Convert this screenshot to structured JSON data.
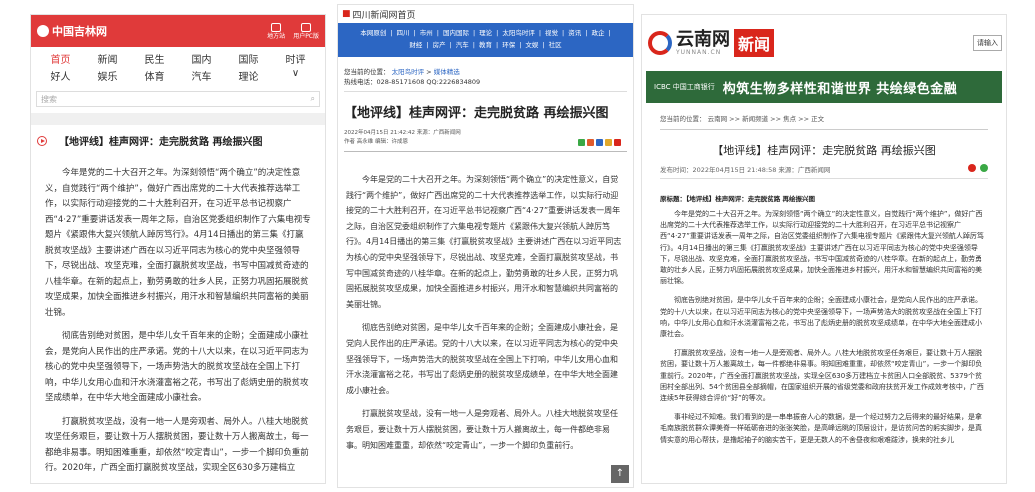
{
  "panel1": {
    "logo": "中国吉林网",
    "topbar_buttons": [
      "地方站",
      "用户PC版"
    ],
    "nav": [
      "首页",
      "新闻",
      "民生",
      "国内",
      "国际",
      "时评",
      "好人",
      "娱乐",
      "体育",
      "汽车",
      "理论",
      "∨"
    ],
    "search_placeholder": "搜索",
    "search_icon": "search-icon",
    "article_title": "【地评线】桂声网评：走完脱贫路 再绘振兴图",
    "paragraphs": [
      "今年是党的二十大召开之年。为深刻领悟“两个确立”的决定性意义，自觉践行“两个维护”，做好广西出席党的二十大代表推荐选举工作，以实际行动迎接党的二十大胜利召开，在习近平总书记视察广西“4·27”重要讲话发表一周年之际，自治区党委组织制作了六集电视专题片《紧跟伟大复兴领航人踔厉笃行》。4月14日播出的第三集《打赢脱贫攻坚战》主要讲述广西在以习近平同志为核心的党中央坚强领导下，尽锐出战、攻坚克难，全面打赢脱贫攻坚战，书写中国减贫奇迹的八桂华章。在新的起点上，勤劳勇敢的壮乡人民，正努力巩固拓展脱贫攻坚成果，加快全面推进乡村振兴，用汗水和智慧编织共同富裕的美丽壮锦。",
      "彻底告别绝对贫困，是中华儿女千百年来的企盼；全面建成小康社会，是党向人民作出的庄严承诺。党的十八大以来，在以习近平同志为核心的党中央坚强领导下，一场声势浩大的脱贫攻坚战在全国上下打响，中华儿女用心血和汗水浇灌富裕之花，书写出了彪炳史册的脱贫攻坚成绩单，在中华大地全面建成小康社会。",
      "打赢脱贫攻坚战，没有一地一人是旁观者、局外人。八桂大地脱贫攻坚任务艰巨，要让数十万人摆脱贫困，要让数十万人搬离故土，每一都绝非易事。明知困难重重，却依然“咬定青山”，一步一个脚印负重前行。2020年，广西全面打赢脱贫攻坚战，实现全区630多万建档立"
    ]
  },
  "panel2": {
    "site_name": "四川新闻网首页",
    "nav_row1": [
      "本网原创",
      "四川",
      "市州",
      "国内国际",
      "理论",
      "太阳鸟时评",
      "视觉",
      "资讯",
      "政企"
    ],
    "nav_row2": [
      "财经",
      "房产",
      "汽车",
      "教育",
      "环保",
      "文娱",
      "社区"
    ],
    "breadcrumb_prefix": "您当前的位置：",
    "breadcrumb_items": [
      "太阳鸟时评",
      ">",
      "媒体精选"
    ],
    "hotline": "热线电话：028-85171608 QQ:2226834809",
    "article_title": "【地评线】桂声网评：走完脱贫路 再绘振兴图",
    "meta_line": "2022年04月15日 21:42:42   来源：广西新闻网",
    "author_line": "作者 高永维  编辑：许成恩",
    "paragraphs": [
      "今年是党的二十大召开之年。为深刻领悟“两个确立”的决定性意义，自觉践行“两个维护”，做好广西出席党的二十大代表推荐选举工作，以实际行动迎接党的二十大胜利召开，在习近平总书记视察广西“4·27”重要讲话发表一周年之际，自治区党委组织制作了六集电视专题片《紧跟伟大复兴领航人踔厉笃行》。4月14日播出的第三集《打赢脱贫攻坚战》主要讲述广西在以习近平同志为核心的党中央坚强领导下，尽锐出战、攻坚克难，全面打赢脱贫攻坚战，书写中国减贫奇迹的八桂华章。在新的起点上，勤劳勇敢的壮乡人民，正努力巩固拓展脱贫攻坚成果，加快全面推进乡村振兴，用汗水和智慧编织共同富裕的美丽壮锦。",
      "彻底告别绝对贫困，是中华儿女千百年来的企盼；全面建成小康社会，是党向人民作出的庄严承诺。党的十八大以来，在以习近平同志为核心的党中央坚强领导下，一场声势浩大的脱贫攻坚战在全国上下打响，中华儿女用心血和汗水浇灌富裕之花，书写出了彪炳史册的脱贫攻坚成绩单，在中华大地全面建成小康社会。",
      "打赢脱贫攻坚战，没有一地一人是旁观者、局外人。八桂大地脱贫攻坚任务艰巨，要让数十万人摆脱贫困，要让数十万人搬离故土，每一件都绝非易事。明知困难重重，却依然“咬定青山”，一步一个脚印负重前行。"
    ],
    "totop_label": "↑"
  },
  "panel3": {
    "site_name": "云南网",
    "site_sub": "YUNNAN.CN",
    "news_label": "新闻",
    "login_label": "请输入",
    "banner_bank": "ICBC 中国工商银行",
    "banner_slogan": "构筑生物多样性和谐世界  共绘绿色金融",
    "breadcrumb": "您当前的位置： 云南网 >> 新闻频道 >> 焦点 >> 正文",
    "article_title": "【地评线】桂声网评：走完脱贫路 再绘振兴图",
    "meta_line": "发布时间：2022年04月15日 21:48:58  来源：广西新闻网",
    "source_title": "原标题：【地评线】桂声网评：走完脱贫路 再绘振兴图",
    "paragraphs": [
      "今年是党的二十大召开之年。为深刻领悟“两个确立”的决定性意义，自觉践行“两个维护”，做好广西出席党的二十大代表推荐选举工作，以实际行动迎接党的二十大胜利召开，在习近平总书记视察广西“4·27”重要讲话发表一周年之际，自治区党委组织制作了六集电视专题片《紧跟伟大复兴领航人踔厉笃行》。4月14日播出的第三集《打赢脱贫攻坚战》主要讲述广西在以习近平同志为核心的党中央坚强领导下，尽锐出战、攻坚克难，全面打赢脱贫攻坚战，书写中国减贫奇迹的八桂华章。在新的起点上，勤劳勇敢的壮乡人民，正努力巩固拓展脱贫攻坚成果，加快全面推进乡村振兴，用汗水和智慧编织共同富裕的美丽壮锦。",
      "彻底告别绝对贫困，是中华儿女千百年来的企盼；全面建成小康社会，是党向人民作出的庄严承诺。党的十八大以来，在以习近平同志为核心的党中央坚强领导下，一场声势浩大的脱贫攻坚战在全国上下打响，中华儿女用心血和汗水浇灌富裕之花，书写出了彪炳史册的脱贫攻坚成绩单，在中华大地全面建成小康社会。",
      "打赢脱贫攻坚战，没有一地一人是旁观者、局外人。八桂大地脱贫攻坚任务艰巨，要让数十万人摆脱贫困，要让数十万人搬离故土，每一件都绝非易事。明知困难重重，却依然“咬定青山”，一步一个脚印负重前行。2020年，广西全面打赢脱贫攻坚战，实现全区630多万建档立卡贫困人口全部脱贫、5379个贫困村全部出列、54个贫困县全部摘帽，在国家组织开展的省级党委和政府扶贫开发工作成效考核中，广西连续5年获得综合评价“好”的等次。",
      "事非经过不知难。我们看到的是一串串振奋人心的数据，是一个经过努力之后得来的最好结果，是拿毛南族脱贫群众谭美脊一样砥砺奋进的张张笑脸，是高峰远眺的顶层设计，是访贫问苦的躬实脚步，是真情实意的用心帮扶，是撸起袖子的脑实苦干，更是无数人的不舍昼夜和艰难跋涉，换来的社乡儿"
    ]
  },
  "colors": {
    "p1_red": "#e03a3a",
    "p2_blue": "#2c66c3",
    "p3_red": "#d9261c",
    "p3_banner_green": "#2e6a3a"
  }
}
